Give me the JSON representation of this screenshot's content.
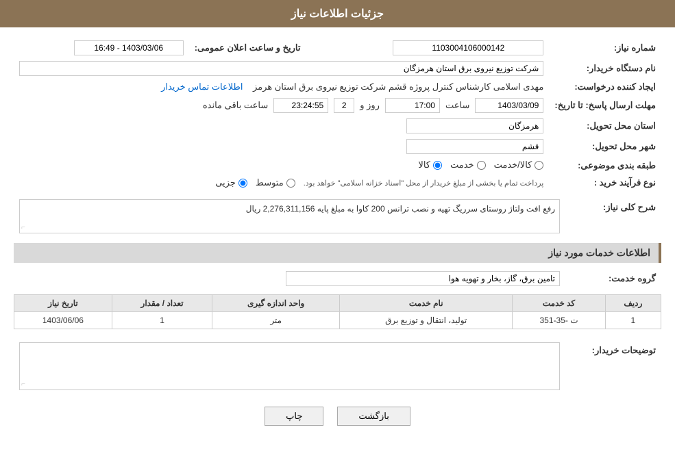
{
  "header": {
    "title": "جزئیات اطلاعات نیاز"
  },
  "fields": {
    "need_number_label": "شماره نیاز:",
    "need_number_value": "1103004106000142",
    "buyer_label": "نام دستگاه خریدار:",
    "buyer_value": "شرکت توزیع نیروی برق استان هرمزگان",
    "creator_label": "ایجاد کننده درخواست:",
    "creator_value": "مهدی اسلامی کارشناس کنترل پروژه قشم شرکت توزیع نیروی برق استان هرمز",
    "creator_link": "اطلاعات تماس خریدار",
    "announce_label": "تاریخ و ساعت اعلان عمومی:",
    "announce_value": "1403/03/06 - 16:49",
    "send_date_label": "مهلت ارسال پاسخ: تا تاریخ:",
    "send_date": "1403/03/09",
    "send_time_label": "ساعت",
    "send_time": "17:00",
    "remaining_days_label": "روز و",
    "remaining_days": "2",
    "remaining_time_label": "ساعت باقی مانده",
    "remaining_time": "23:24:55",
    "province_label": "استان محل تحویل:",
    "province_value": "هرمزگان",
    "city_label": "شهر محل تحویل:",
    "city_value": "قشم",
    "category_label": "طبقه بندی موضوعی:",
    "category_options": [
      "کالا",
      "خدمت",
      "کالا/خدمت"
    ],
    "category_selected": "کالا",
    "purchase_type_label": "نوع فرآیند خرید :",
    "purchase_type_options": [
      "جزیی",
      "متوسط"
    ],
    "purchase_type_note": "پرداخت تمام یا بخشی از مبلغ خریدار از محل \"اسناد خزانه اسلامی\" خواهد بود.",
    "description_label": "شرح کلی نیاز:",
    "description_value": "رفع افت ولتاژ روستای سرریگ تهیه و نصب ترانس 200 کاوا به مبلغ پایه  2,276,311,156 ریال",
    "service_info_title": "اطلاعات خدمات مورد نیاز",
    "service_group_label": "گروه خدمت:",
    "service_group_value": "تامین برق، گاز، بخار و تهویه هوا",
    "table": {
      "headers": [
        "ردیف",
        "کد خدمت",
        "نام خدمت",
        "واحد اندازه گیری",
        "تعداد / مقدار",
        "تاریخ نیاز"
      ],
      "rows": [
        {
          "row": "1",
          "code": "ت -35-351",
          "name": "تولید، انتقال و توزیع برق",
          "unit": "متر",
          "count": "1",
          "date": "1403/06/06"
        }
      ]
    },
    "buyer_comments_label": "توضیحات خریدار:",
    "buyer_comments_value": ""
  },
  "buttons": {
    "print": "چاپ",
    "back": "بازگشت"
  }
}
